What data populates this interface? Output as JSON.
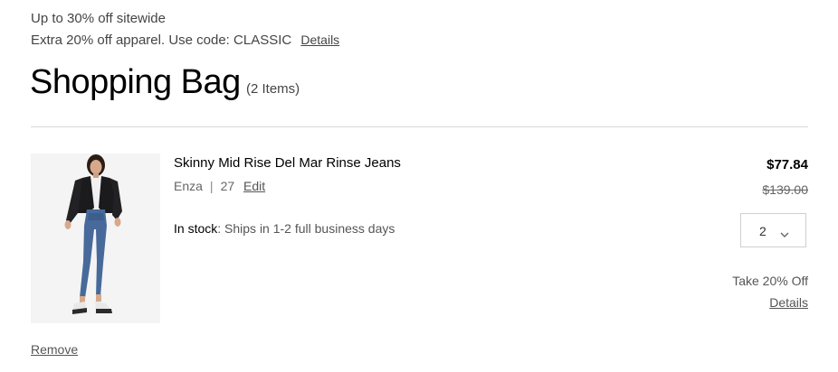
{
  "promo": {
    "line1": "Up to 30% off sitewide",
    "line2": "Extra 20% off apparel. Use code: CLASSIC",
    "details_label": "Details"
  },
  "bag": {
    "title": "Shopping Bag",
    "count": "(2 Items)"
  },
  "item": {
    "name": "Skinny Mid Rise Del Mar Rinse Jeans",
    "color": "Enza",
    "separator": "|",
    "size": "27",
    "edit_label": "Edit",
    "stock_status": "In stock",
    "stock_detail": ": Ships in 1-2 full business days",
    "price": "$77.84",
    "original_price": "$139.00",
    "quantity": "2",
    "offer": "Take 20% Off",
    "offer_details_label": "Details",
    "remove_label": "Remove",
    "image_icon": "product-photo"
  },
  "colors": {
    "text": "#000000",
    "muted": "#555555",
    "divider": "#d9d9d9"
  }
}
